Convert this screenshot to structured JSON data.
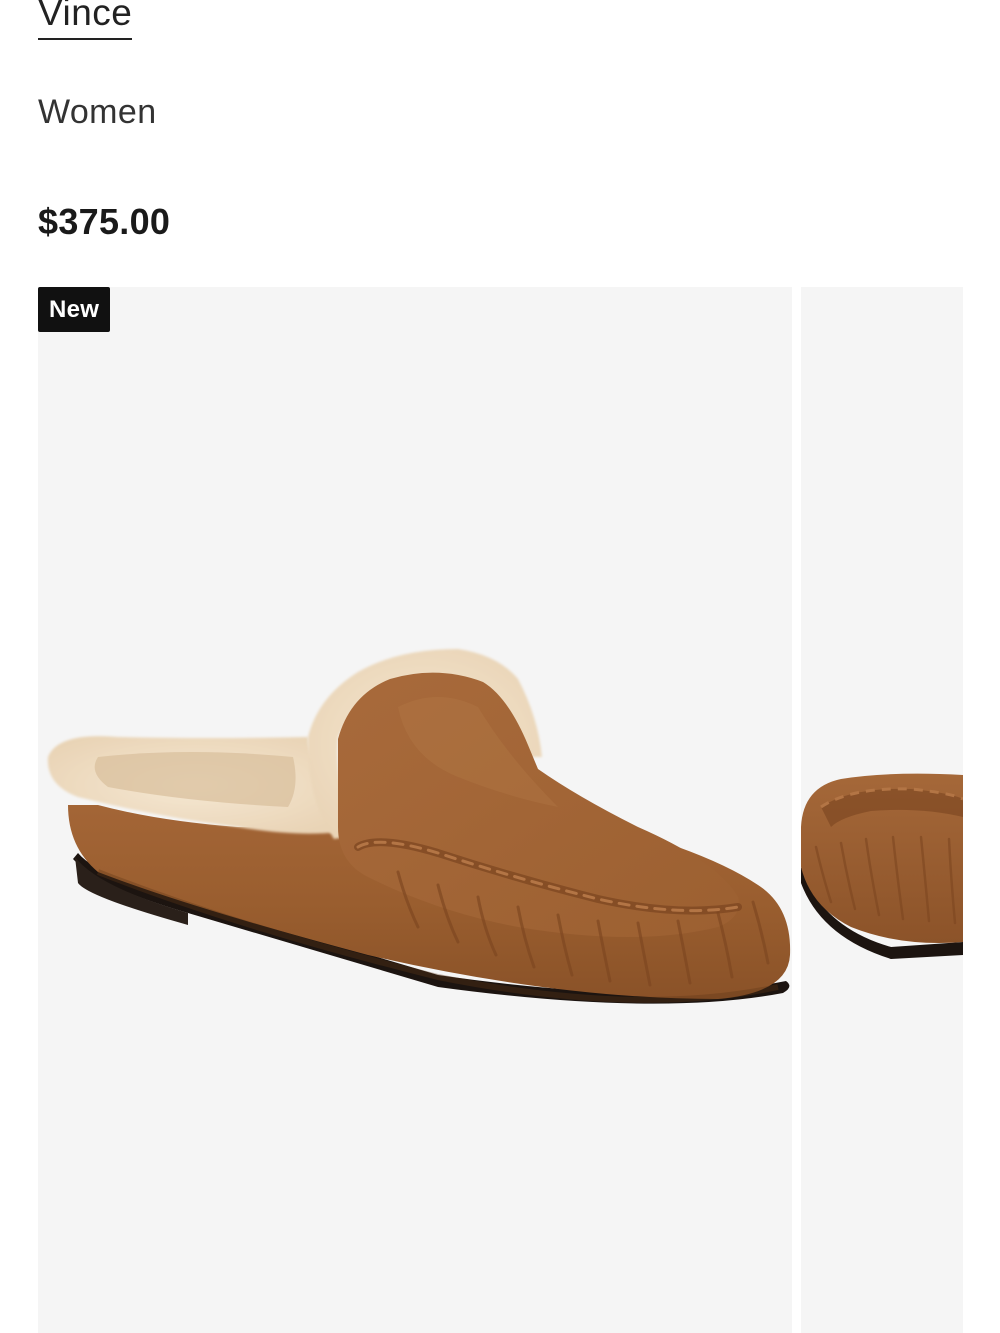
{
  "product": {
    "brand": "Vince",
    "category": "Women",
    "price": "$375.00",
    "badge": "New"
  },
  "gallery": {
    "images": [
      {
        "name": "product-image-main",
        "depicts": "suede-shearling-mule-slipper"
      },
      {
        "name": "product-image-next",
        "depicts": "suede-shearling-mule-slipper-alt"
      }
    ]
  },
  "colors": {
    "suede": "#9b5f2e",
    "shearling": "#eedcc2",
    "image_background": "#f5f5f5",
    "badge_background": "#111111",
    "badge_text": "#ffffff"
  }
}
